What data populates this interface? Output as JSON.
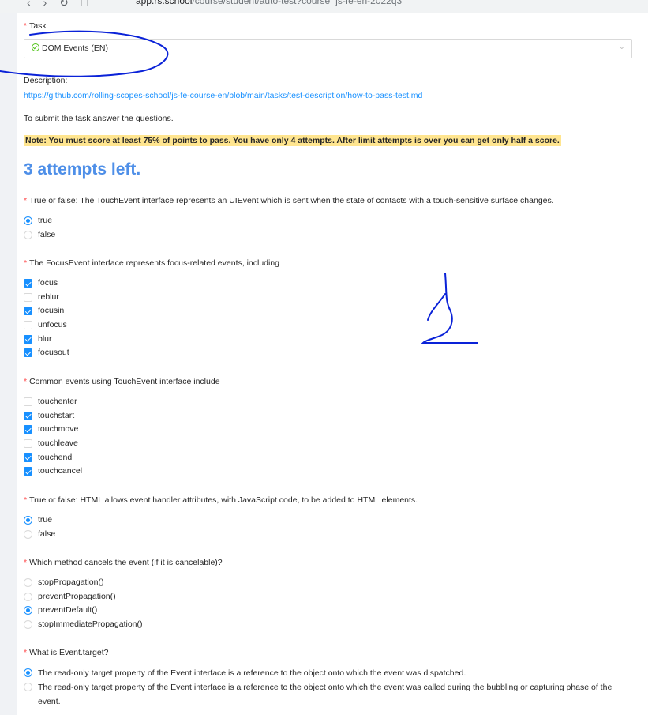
{
  "browser": {
    "url_host": "app.rs.school",
    "url_path": "/course/student/auto-test?course=js-fe-en-2022q3"
  },
  "task": {
    "label": "Task",
    "selected": "DOM Events (EN)"
  },
  "description": {
    "label": "Description:",
    "link": "https://github.com/rolling-scopes-school/js-fe-course-en/blob/main/tasks/test-description/how-to-pass-test.md"
  },
  "submit_text": "To submit the task answer the questions.",
  "note": "Note: You must score at least 75% of points to pass. You have only 4 attempts. After limit attempts is over you can get only half a score.",
  "attempts": "3 attempts left.",
  "questions": [
    {
      "title": "True or false: The TouchEvent interface represents an UIEvent which is sent when the state of contacts with a touch-sensitive surface changes.",
      "type": "radio",
      "options": [
        {
          "label": "true",
          "checked": true
        },
        {
          "label": "false",
          "checked": false
        }
      ]
    },
    {
      "title": "The FocusEvent interface represents focus-related events, including",
      "type": "checkbox",
      "options": [
        {
          "label": "focus",
          "checked": true
        },
        {
          "label": "reblur",
          "checked": false
        },
        {
          "label": "focusin",
          "checked": true
        },
        {
          "label": "unfocus",
          "checked": false
        },
        {
          "label": "blur",
          "checked": true
        },
        {
          "label": "focusout",
          "checked": true
        }
      ]
    },
    {
      "title": "Common events using TouchEvent interface include",
      "type": "checkbox",
      "options": [
        {
          "label": "touchenter",
          "checked": false
        },
        {
          "label": "touchstart",
          "checked": true
        },
        {
          "label": "touchmove",
          "checked": true
        },
        {
          "label": "touchleave",
          "checked": false
        },
        {
          "label": "touchend",
          "checked": true
        },
        {
          "label": "touchcancel",
          "checked": true
        }
      ]
    },
    {
      "title": "True or false: HTML allows event handler attributes, with JavaScript code, to be added to HTML elements.",
      "type": "radio",
      "options": [
        {
          "label": "true",
          "checked": true
        },
        {
          "label": "false",
          "checked": false
        }
      ]
    },
    {
      "title": "Which method cancels the event (if it is cancelable)?",
      "type": "radio",
      "options": [
        {
          "label": "stopPropagation()",
          "checked": false
        },
        {
          "label": "preventPropagation()",
          "checked": false
        },
        {
          "label": "preventDefault()",
          "checked": true
        },
        {
          "label": "stopImmediatePropagation()",
          "checked": false
        }
      ]
    },
    {
      "title": "What is Event.target?",
      "type": "radio",
      "options": [
        {
          "label": "The read-only target property of the Event interface is a reference to the object onto which the event was dispatched.",
          "checked": true
        },
        {
          "label": "The read-only target property of the Event interface is a reference to the object onto which the event was called during the bubbling or capturing phase of the event.",
          "checked": false
        }
      ]
    }
  ],
  "colors": {
    "accent": "#1890ff",
    "required": "#ff4d4f",
    "attempts": "#4e8fe8",
    "note_bg": "#ffe58f",
    "ink": "#0a22d8"
  }
}
